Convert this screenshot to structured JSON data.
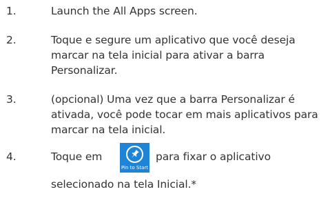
{
  "steps": [
    {
      "number": "1.",
      "lines": [
        "Launch the All Apps screen."
      ]
    },
    {
      "number": "2.",
      "lines": [
        "Toque e segure um aplicativo que você deseja",
        "marcar na tela inicial para ativar a barra",
        "Personalizar."
      ]
    },
    {
      "number": "3.",
      "lines": [
        "(opcional) Uma vez que a barra Personalizar é",
        "ativada, você pode tocar em mais aplicativos para",
        "marcar na tela inicial."
      ]
    },
    {
      "number": "4.",
      "before_icon": "Toque em",
      "after_icon": "para fixar o aplicativo",
      "continuation": "selecionado na tela Inicial.*",
      "icon": {
        "name": "pin-icon",
        "label": "Pin to Start",
        "color": "#1f84d6"
      }
    }
  ]
}
